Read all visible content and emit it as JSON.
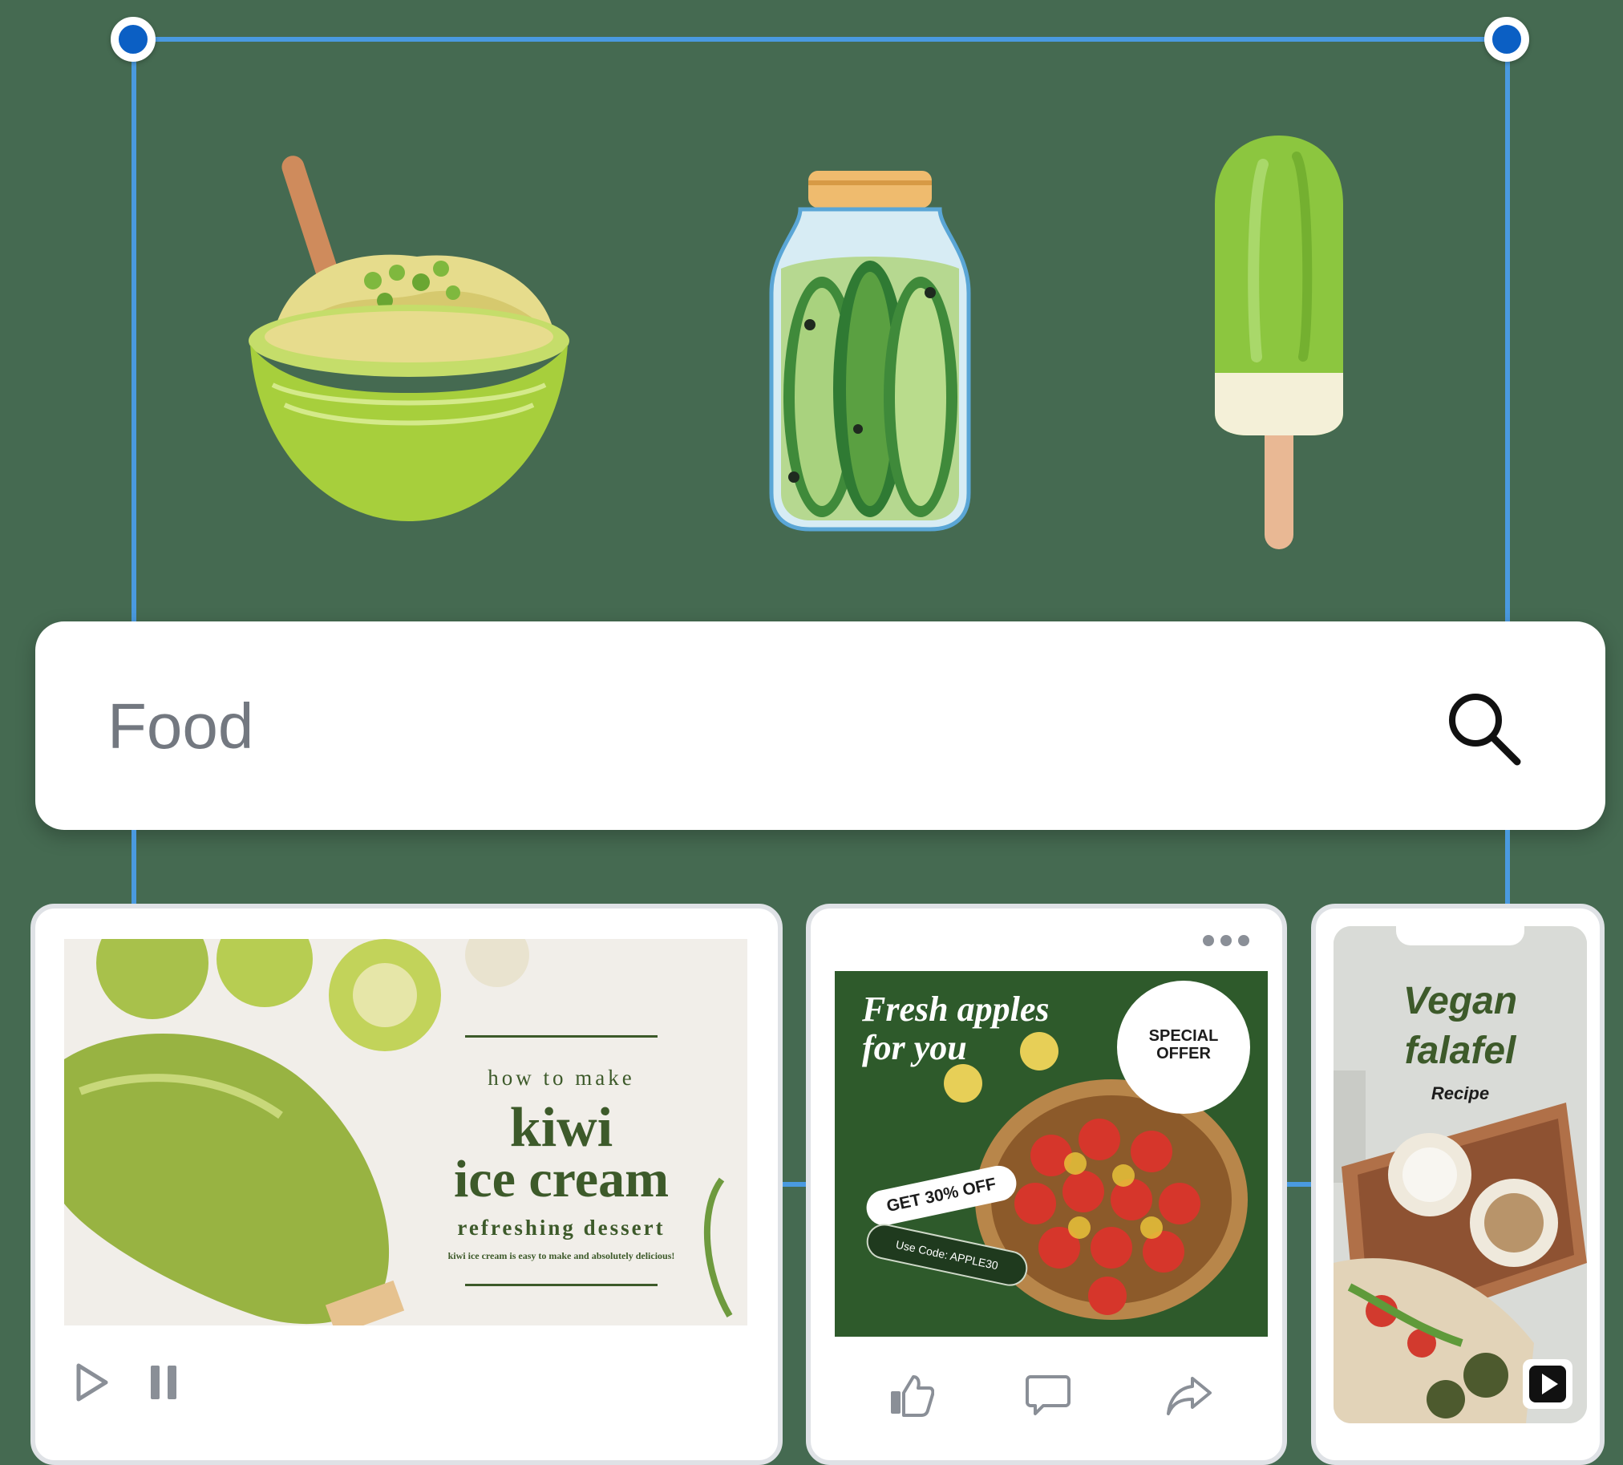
{
  "search": {
    "placeholder": "Food",
    "icon": "search-icon"
  },
  "canvas": {
    "illustrations": [
      "bowl-of-mashed-potatoes-with-peas-icon",
      "pickle-jar-icon",
      "green-popsicle-icon"
    ]
  },
  "cards": {
    "video": {
      "title_small": "how to make",
      "title_line1": "kiwi",
      "title_line2": "ice cream",
      "subtitle": "refreshing dessert",
      "caption": "kiwi ice cream is easy to make and absolutely delicious!",
      "controls": [
        "play-icon",
        "pause-icon"
      ]
    },
    "social_post": {
      "headline_line1": "Fresh apples",
      "headline_line2": "for you",
      "badge_line1": "SPECIAL",
      "badge_line2": "OFFER",
      "discount": "GET 30% OFF",
      "code": "Use Code: APPLE30",
      "actions": [
        "like-icon",
        "comment-icon",
        "share-icon"
      ],
      "menu_icon": "more-dots-icon"
    },
    "story": {
      "title_line1": "Vegan",
      "title_line2": "falafel",
      "subtitle": "Recipe",
      "play_icon": "play-icon"
    }
  },
  "colors": {
    "background": "#456a51",
    "selection": "#4a9ae0",
    "handle": "#0b5fc4",
    "title_green": "#3d5a2a"
  }
}
